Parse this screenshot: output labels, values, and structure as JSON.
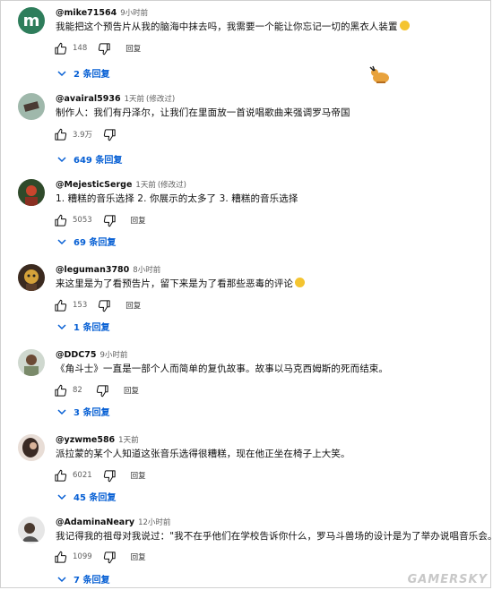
{
  "comments": [
    {
      "author": "@mike71564",
      "time": "9小时前",
      "edited": "",
      "text": "我能把这个预告片从我的脑海中抹去吗，我需要一个能让你忘记一切的黑衣人装置",
      "likes": "148",
      "reply_label": "回复",
      "replies": "2 条回复",
      "avatar_letter": "m"
    },
    {
      "author": "@avairal5936",
      "time": "1天前",
      "edited": "(修改过)",
      "text": "制作人：我们有丹泽尔，让我们在里面放一首说唱歌曲来强调罗马帝国",
      "likes": "3.9万",
      "reply_label": "",
      "replies": "649 条回复"
    },
    {
      "author": "@MejesticSerge",
      "time": "1天前",
      "edited": "(修改过)",
      "text": "1. 糟糕的音乐选择 2. 你展示的太多了 3. 糟糕的音乐选择",
      "likes": "5053",
      "reply_label": "回复",
      "replies": "69 条回复"
    },
    {
      "author": "@leguman3780",
      "time": "8小时前",
      "edited": "",
      "text": "来这里是为了看预告片，留下来是为了看那些恶毒的评论",
      "likes": "153",
      "reply_label": "回复",
      "replies": "1 条回复"
    },
    {
      "author": "@DDC75",
      "time": "9小时前",
      "edited": "",
      "text": "《角斗士》一直是一部个人而简单的复仇故事。故事以马克西姆斯的死而结束。",
      "likes": "82",
      "reply_label": "回复",
      "replies": "3 条回复"
    },
    {
      "author": "@yzwme586",
      "time": "1天前",
      "edited": "",
      "text": "派拉蒙的某个人知道这张音乐选得很糟糕，现在他正坐在椅子上大笑。",
      "likes": "6021",
      "reply_label": "回复",
      "replies": "45 条回复"
    },
    {
      "author": "@AdaminaNeary",
      "time": "12小时前",
      "edited": "",
      "text": "我记得我的祖母对我说过：\"我不在乎他们在学校告诉你什么，罗马斗兽场的设计是为了举办说唱音乐会。\"",
      "likes": "1099",
      "reply_label": "回复",
      "replies": "7 条回复"
    }
  ],
  "watermark": "GAMERSKY",
  "colors": {
    "reply_link": "#065fd4",
    "meta": "#606060"
  }
}
